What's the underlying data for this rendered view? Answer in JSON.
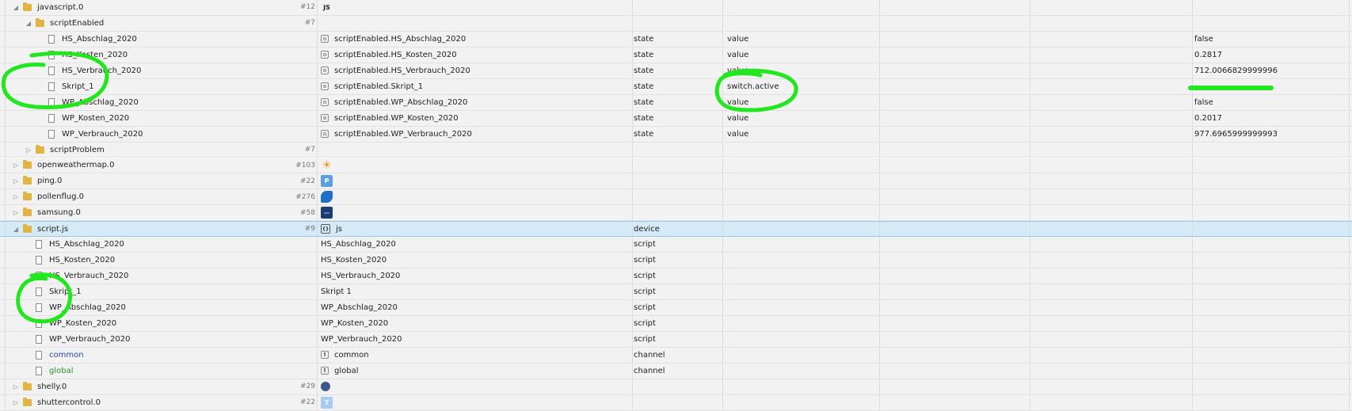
{
  "rows": [
    {
      "indent": 0,
      "toggle": "open",
      "icon": "folder",
      "name": "javascript.0",
      "count": "#12",
      "adapter": "javascript",
      "adapter_text": "JS"
    },
    {
      "indent": 1,
      "toggle": "open",
      "icon": "folder",
      "name": "scriptEnabled",
      "count": "#7"
    },
    {
      "indent": 2,
      "toggle": "",
      "icon": "file",
      "name": "HS_Abschlag_2020",
      "id_icon": "state",
      "id": "scriptEnabled.HS_Abschlag_2020",
      "type": "state",
      "role": "value",
      "value": "false"
    },
    {
      "indent": 2,
      "toggle": "",
      "icon": "file",
      "name": "HS_Kosten_2020",
      "id_icon": "state",
      "id": "scriptEnabled.HS_Kosten_2020",
      "type": "state",
      "role": "value",
      "value": "0.2817"
    },
    {
      "indent": 2,
      "toggle": "",
      "icon": "file",
      "name": "HS_Verbrauch_2020",
      "id_icon": "state",
      "id": "scriptEnabled.HS_Verbrauch_2020",
      "type": "state",
      "role": "value",
      "value": "712.0066829999996"
    },
    {
      "indent": 2,
      "toggle": "",
      "icon": "file",
      "name": "Skript_1",
      "id_icon": "state",
      "id": "scriptEnabled.Skript_1",
      "type": "state",
      "role": "switch.active",
      "value": ""
    },
    {
      "indent": 2,
      "toggle": "",
      "icon": "file",
      "name": "WP_Abschlag_2020",
      "id_icon": "state",
      "id": "scriptEnabled.WP_Abschlag_2020",
      "type": "state",
      "role": "value",
      "value": "false"
    },
    {
      "indent": 2,
      "toggle": "",
      "icon": "file",
      "name": "WP_Kosten_2020",
      "id_icon": "state",
      "id": "scriptEnabled.WP_Kosten_2020",
      "type": "state",
      "role": "value",
      "value": "0.2017"
    },
    {
      "indent": 2,
      "toggle": "",
      "icon": "file",
      "name": "WP_Verbrauch_2020",
      "id_icon": "state",
      "id": "scriptEnabled.WP_Verbrauch_2020",
      "type": "state",
      "role": "value",
      "value": "977.6965999999993"
    },
    {
      "indent": 1,
      "toggle": "closed",
      "icon": "folder",
      "name": "scriptProblem",
      "count": "#7"
    },
    {
      "indent": 0,
      "toggle": "closed",
      "icon": "folder",
      "name": "openweathermap.0",
      "count": "#103",
      "adapter": "sun",
      "adapter_text": "☀"
    },
    {
      "indent": 0,
      "toggle": "closed",
      "icon": "folder",
      "name": "ping.0",
      "count": "#22",
      "adapter": "p",
      "adapter_text": "P"
    },
    {
      "indent": 0,
      "toggle": "closed",
      "icon": "folder",
      "name": "pollenflug.0",
      "count": "#276",
      "adapter": "pollen",
      "adapter_text": ""
    },
    {
      "indent": 0,
      "toggle": "closed",
      "icon": "folder",
      "name": "samsung.0",
      "count": "#58",
      "adapter": "tv",
      "adapter_text": "—"
    },
    {
      "indent": 0,
      "toggle": "open",
      "icon": "folder",
      "name": "script.js",
      "count": "#9",
      "id_icon": "jsicon",
      "id": "js",
      "type": "device",
      "selected": true
    },
    {
      "indent": 1,
      "toggle": "",
      "icon": "file",
      "name": "HS_Abschlag_2020",
      "id": "HS_Abschlag_2020",
      "type": "script"
    },
    {
      "indent": 1,
      "toggle": "",
      "icon": "file",
      "name": "HS_Kosten_2020",
      "id": "HS_Kosten_2020",
      "type": "script"
    },
    {
      "indent": 1,
      "toggle": "",
      "icon": "file",
      "name": "HS_Verbrauch_2020",
      "id": "HS_Verbrauch_2020",
      "type": "script"
    },
    {
      "indent": 1,
      "toggle": "",
      "icon": "file",
      "name": "Skript_1",
      "id": "Skript 1",
      "type": "script"
    },
    {
      "indent": 1,
      "toggle": "",
      "icon": "file",
      "name": "WP_Abschlag_2020",
      "id": "WP_Abschlag_2020",
      "type": "script"
    },
    {
      "indent": 1,
      "toggle": "",
      "icon": "file",
      "name": "WP_Kosten_2020",
      "id": "WP_Kosten_2020",
      "type": "script"
    },
    {
      "indent": 1,
      "toggle": "",
      "icon": "file",
      "name": "WP_Verbrauch_2020",
      "id": "WP_Verbrauch_2020",
      "type": "script"
    },
    {
      "indent": 1,
      "toggle": "",
      "icon": "file",
      "name": "common",
      "name_color": "blue",
      "id_icon": "channel",
      "id": "common",
      "type": "channel"
    },
    {
      "indent": 1,
      "toggle": "",
      "icon": "file",
      "name": "global",
      "name_color": "green",
      "id_icon": "channel",
      "id": "global",
      "type": "channel"
    },
    {
      "indent": 0,
      "toggle": "closed",
      "icon": "folder",
      "name": "shelly.0",
      "count": "#29",
      "adapter": "shelly",
      "adapter_text": ""
    },
    {
      "indent": 0,
      "toggle": "closed",
      "icon": "folder",
      "name": "shuttercontrol.0",
      "count": "#22",
      "adapter": "shutter",
      "adapter_text": "T"
    }
  ],
  "colors": {
    "annotation": "#22e61e",
    "selected_bg": "#d4eaf6",
    "row_bg": "#f2f2f2"
  }
}
